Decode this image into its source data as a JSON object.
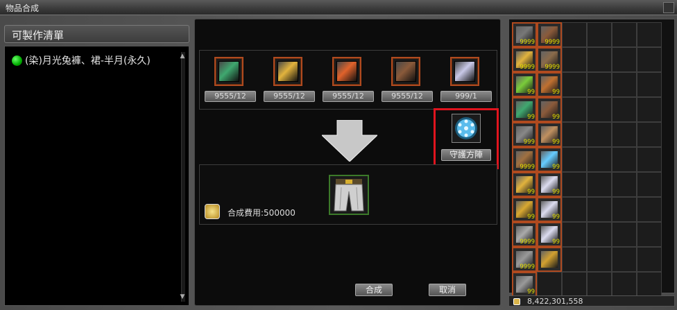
{
  "window": {
    "title": "物品合成"
  },
  "craft_list": {
    "header": "可製作清單",
    "items": [
      {
        "label": "(染)月光兔褲、裙-半月(永久)",
        "status_color": "#00cc00"
      }
    ]
  },
  "materials": [
    {
      "icon": "green-crystal-icon",
      "qty": "9555/12",
      "color": "#3fa86f"
    },
    {
      "icon": "gold-ore-icon",
      "qty": "9555/12",
      "color": "#e2b33d"
    },
    {
      "icon": "fire-powder-icon",
      "qty": "9555/12",
      "color": "#e0622b"
    },
    {
      "icon": "wood-plank-icon",
      "qty": "9555/12",
      "color": "#8a5a3a"
    },
    {
      "icon": "c-ticket-icon",
      "qty": "999/1",
      "color": "#c9c9e8"
    }
  ],
  "guard_stone": {
    "label": "守護方陣",
    "icon": "blue-snowflake-orb-icon"
  },
  "result": {
    "icon": "pants-icon",
    "cost_label": "合成費用:500000"
  },
  "actions": {
    "combine": "合成",
    "cancel": "取消"
  },
  "inventory": {
    "items": [
      {
        "icon": "gray-stone-icon",
        "count": "9999",
        "color": "#777"
      },
      {
        "icon": "wood-plank-icon",
        "count": "9999",
        "color": "#8a5a3a"
      },
      {
        "icon": "gold-ore-icon",
        "count": "9999",
        "color": "#e2b33d"
      },
      {
        "icon": "wood-plank-icon",
        "count": "9999",
        "color": "#8a6a4a"
      },
      {
        "icon": "green-herb-icon",
        "count": "99",
        "color": "#7acc3a"
      },
      {
        "icon": "copper-ore-icon",
        "count": "99",
        "color": "#c07030"
      },
      {
        "icon": "green-crystal-icon",
        "count": "99",
        "color": "#3fa86f"
      },
      {
        "icon": "wood-plank-icon",
        "count": "99",
        "color": "#8a5a3a"
      },
      {
        "icon": "gray-stone-icon",
        "count": "999",
        "color": "#888"
      },
      {
        "icon": "scroll-icon",
        "count": "99",
        "color": "#c09060"
      },
      {
        "icon": "bronze-ore-icon",
        "count": "9999",
        "color": "#a07040"
      },
      {
        "icon": "blue-snowflake-orb-icon",
        "count": "99",
        "color": "#66ccff"
      },
      {
        "icon": "gold-ore-icon",
        "count": "99",
        "color": "#e2b33d"
      },
      {
        "icon": "b-ticket-icon",
        "count": "99",
        "color": "#dcdcf0"
      },
      {
        "icon": "gold-ore-icon",
        "count": "99",
        "color": "#d9a830"
      },
      {
        "icon": "a-ticket-icon",
        "count": "99",
        "color": "#dcdcf0"
      },
      {
        "icon": "silver-ore-icon",
        "count": "9999",
        "color": "#aaa"
      },
      {
        "icon": "c-ticket-icon",
        "count": "99",
        "color": "#dcdcf0"
      },
      {
        "icon": "silver-ore-icon",
        "count": "9999",
        "color": "#999"
      },
      {
        "icon": "b-box-icon",
        "count": "",
        "color": "#d2a030"
      },
      {
        "icon": "silver-ore-icon",
        "count": "99",
        "color": "#999"
      }
    ]
  },
  "gold": {
    "amount": "8,422,301,558"
  }
}
